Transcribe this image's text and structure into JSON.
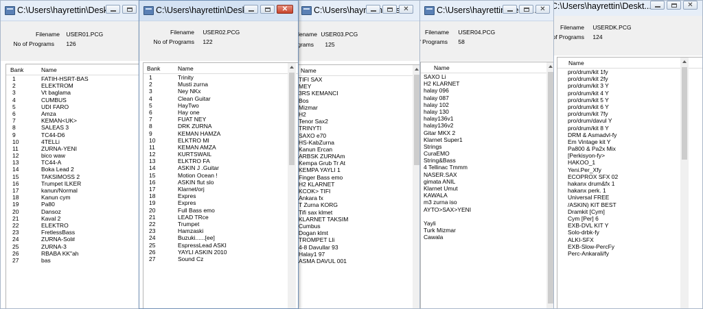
{
  "common": {
    "filename_label": "Filename",
    "programs_label": "No of Programs",
    "bank_header": "Bank",
    "name_header": "Name",
    "min_symbol": "–",
    "max_symbol": "□",
    "close_symbol": "✕"
  },
  "windows": [
    {
      "id": "w1",
      "title": "C:\\Users\\hayrettin\\Deskt...",
      "filename": "USER01.PCG",
      "programs": "126",
      "rows": [
        {
          "n": "1",
          "name": "FATIH-HSRT-BAS"
        },
        {
          "n": "2",
          "name": "ELEKTROM"
        },
        {
          "n": "3",
          "name": "Vt baglama"
        },
        {
          "n": "4",
          "name": "CUMBUS"
        },
        {
          "n": "5",
          "name": "UDI FARO"
        },
        {
          "n": "6",
          "name": " Amza"
        },
        {
          "n": "7",
          "name": "KEMAN<UK>"
        },
        {
          "n": "8",
          "name": "SALEAS 3"
        },
        {
          "n": "9",
          "name": "TC44-D6"
        },
        {
          "n": "10",
          "name": "4TELLi"
        },
        {
          "n": "11",
          "name": "ZURNA-YENI"
        },
        {
          "n": "12",
          "name": "bico waw"
        },
        {
          "n": "13",
          "name": "TC44-A"
        },
        {
          "n": "14",
          "name": "Boka Lead 2"
        },
        {
          "n": "15",
          "name": "TAKSIMOSS 2"
        },
        {
          "n": "16",
          "name": "Trumpet ILKER"
        },
        {
          "n": "17",
          "name": "kanun/Normal"
        },
        {
          "n": "18",
          "name": "Kanun  cym"
        },
        {
          "n": "19",
          "name": "Pa80"
        },
        {
          "n": "20",
          "name": "Dansoz"
        },
        {
          "n": "21",
          "name": "Kaval 2"
        },
        {
          "n": "22",
          "name": "ELEKTRO"
        },
        {
          "n": "23",
          "name": "FretlessBass"
        },
        {
          "n": "24",
          "name": "ZURNA-Sol#"
        },
        {
          "n": "25",
          "name": "ZURNA-3"
        },
        {
          "n": "26",
          "name": "RBABA KK\"ah"
        },
        {
          "n": "27",
          "name": "bas"
        }
      ]
    },
    {
      "id": "w2",
      "title": "C:\\Users\\hayrettin\\Deskt...",
      "filename": "USER02.PCG",
      "programs": "122",
      "rows": [
        {
          "n": "1",
          "name": "Trinity"
        },
        {
          "n": "2",
          "name": "Musti zurna"
        },
        {
          "n": "3",
          "name": "Ney NKx"
        },
        {
          "n": "4",
          "name": "Clean Guitar"
        },
        {
          "n": "5",
          "name": "HayTwo"
        },
        {
          "n": "6",
          "name": "Hay one"
        },
        {
          "n": "7",
          "name": "FUAT NEY"
        },
        {
          "n": "8",
          "name": "DRK ZURNA"
        },
        {
          "n": "9",
          "name": "KEMAN HAMZA"
        },
        {
          "n": "10",
          "name": "ELKTRO MI"
        },
        {
          "n": "11",
          "name": "KEMAN AMZA"
        },
        {
          "n": "12",
          "name": "KURTSWAIL"
        },
        {
          "n": "13",
          "name": "ELKTRO FA"
        },
        {
          "n": "14",
          "name": "ASKIN J .Guitar"
        },
        {
          "n": "15",
          "name": "Motion Ocean !"
        },
        {
          "n": "16",
          "name": "ASKIN flut slo"
        },
        {
          "n": "17",
          "name": "Klarnet/orj"
        },
        {
          "n": "18",
          "name": "Expres"
        },
        {
          "n": "19",
          "name": "Expres"
        },
        {
          "n": "20",
          "name": "Full Bass emo"
        },
        {
          "n": "21",
          "name": "LEAD TRce"
        },
        {
          "n": "22",
          "name": "Trumpet"
        },
        {
          "n": "23",
          "name": "Hamzaski"
        },
        {
          "n": "24",
          "name": "Buzuki......[ee]"
        },
        {
          "n": "25",
          "name": "EspressLead ASKI"
        },
        {
          "n": "26",
          "name": "YAYLI ASKIN 2010"
        },
        {
          "n": "27",
          "name": "Sound Cz"
        }
      ]
    },
    {
      "id": "w3",
      "title": "C:\\Users\\hayrettin\\Deskt...",
      "filename": "USER03.PCG",
      "programs": "125",
      "rows": [
        {
          "n": "",
          "name": "TIFI SAX"
        },
        {
          "n": "",
          "name": "MEY"
        },
        {
          "n": "",
          "name": "3RS KEMANCI"
        },
        {
          "n": "",
          "name": "Bos"
        },
        {
          "n": "",
          "name": "Mizmar"
        },
        {
          "n": "",
          "name": "H2"
        },
        {
          "n": "",
          "name": "Tenor Sax2"
        },
        {
          "n": "",
          "name": "TRINYTI"
        },
        {
          "n": "",
          "name": "SAXO e70"
        },
        {
          "n": "",
          "name": "HS-KabZurna"
        },
        {
          "n": "",
          "name": "Kanun  Ercan"
        },
        {
          "n": "",
          "name": "ARBSK ZURNAm"
        },
        {
          "n": "",
          "name": "Kempa Grub Tr At"
        },
        {
          "n": "",
          "name": "KEMPA YAYLI 1"
        },
        {
          "n": "",
          "name": "Finger Bass emo"
        },
        {
          "n": "",
          "name": "H2 KLARNET"
        },
        {
          "n": "",
          "name": "KCOK> TIFI"
        },
        {
          "n": "",
          "name": "Ankara fx"
        },
        {
          "n": "",
          "name": "T Zurna KORG"
        },
        {
          "n": "",
          "name": "Tifi sax klmet"
        },
        {
          "n": "",
          "name": "KLARNET TAKSIM"
        },
        {
          "n": "",
          "name": "Cumbus"
        },
        {
          "n": "",
          "name": "Dogan klmt"
        },
        {
          "n": "",
          "name": "TROMPET Lli"
        },
        {
          "n": "",
          "name": "4-8 Davullar 93"
        },
        {
          "n": "",
          "name": "Halay1 97"
        },
        {
          "n": "",
          "name": "ASMA DAVUL 001"
        }
      ]
    },
    {
      "id": "w4",
      "title": "C:\\Users\\hayrettin\\Deskt...",
      "filename": "USER04.PCG",
      "programs": "58",
      "rows": [
        {
          "n": "",
          "name": "SAXO Li"
        },
        {
          "n": "",
          "name": "H2 KLARNET"
        },
        {
          "n": "",
          "name": "halay 096"
        },
        {
          "n": "",
          "name": "halay 087"
        },
        {
          "n": "",
          "name": "halay 102"
        },
        {
          "n": "",
          "name": "halay 130"
        },
        {
          "n": "",
          "name": "halay136v1"
        },
        {
          "n": "",
          "name": "halay136v2"
        },
        {
          "n": "",
          "name": "Gitar MKX 2"
        },
        {
          "n": "",
          "name": "Klarnet Super1"
        },
        {
          "n": "",
          "name": "Strings"
        },
        {
          "n": "",
          "name": "CuraEMO"
        },
        {
          "n": "",
          "name": "String&Bass"
        },
        {
          "n": "",
          "name": "4 Tellinac Tmmm"
        },
        {
          "n": "",
          "name": "NASER.SAX"
        },
        {
          "n": "",
          "name": "gimata ANIL"
        },
        {
          "n": "",
          "name": "Klarnet Umut"
        },
        {
          "n": "",
          "name": "KAWALA"
        },
        {
          "n": "",
          "name": "m3 zurna iso"
        },
        {
          "n": "",
          "name": "AYTO>SAX>YENI"
        },
        {
          "n": "",
          "name": ""
        },
        {
          "n": "",
          "name": "Yayli"
        },
        {
          "n": "",
          "name": "Turk Mizmar"
        },
        {
          "n": "",
          "name": "Cawala"
        }
      ]
    },
    {
      "id": "w5",
      "title": "C:\\Users\\hayrettin\\Deskt...",
      "filename": "USERDK.PCG",
      "programs": "124",
      "rows": [
        {
          "n": "",
          "name": "pro/drum/kit 1fy"
        },
        {
          "n": "",
          "name": "pro/drum/kit 2fy"
        },
        {
          "n": "",
          "name": "pro/drum/kit 3 Y"
        },
        {
          "n": "",
          "name": "pro/drum/kit 4 Y"
        },
        {
          "n": "",
          "name": "pro/drum/kit 5 Y"
        },
        {
          "n": "",
          "name": "pro/drum/kit 6 Y"
        },
        {
          "n": "",
          "name": "pro/drum/kit 7fy"
        },
        {
          "n": "",
          "name": "pro/drum/davul Y"
        },
        {
          "n": "",
          "name": "pro/drum/kit 8 Y"
        },
        {
          "n": "",
          "name": "DRM & Asmadvl-fy"
        },
        {
          "n": "",
          "name": "Em Vintage kit Y"
        },
        {
          "n": "",
          "name": "Pa800 & Pa2x Mix"
        },
        {
          "n": "",
          "name": "[Perkisyon-fy>"
        },
        {
          "n": "",
          "name": "HAKOO_1"
        },
        {
          "n": "",
          "name": "Yeni.Per_Xfy"
        },
        {
          "n": "",
          "name": "ECOPROX SFX 02"
        },
        {
          "n": "",
          "name": "hakanx drum&fx 1"
        },
        {
          "n": "",
          "name": "hakanx perk. 1"
        },
        {
          "n": "",
          "name": "Universal FREE"
        },
        {
          "n": "",
          "name": "/ASKIN) KIT BEST"
        },
        {
          "n": "",
          "name": "Dramkit [Cym]"
        },
        {
          "n": "",
          "name": "Cym  [Per] 6"
        },
        {
          "n": "",
          "name": "EXB-DVL KIT Y"
        },
        {
          "n": "",
          "name": "Solo-drbk-fy"
        },
        {
          "n": "",
          "name": "ALKI-SFX"
        },
        {
          "n": "",
          "name": "EXB-Slow-PercFy"
        },
        {
          "n": "",
          "name": "Perc-Ankarali/fy"
        }
      ]
    }
  ]
}
